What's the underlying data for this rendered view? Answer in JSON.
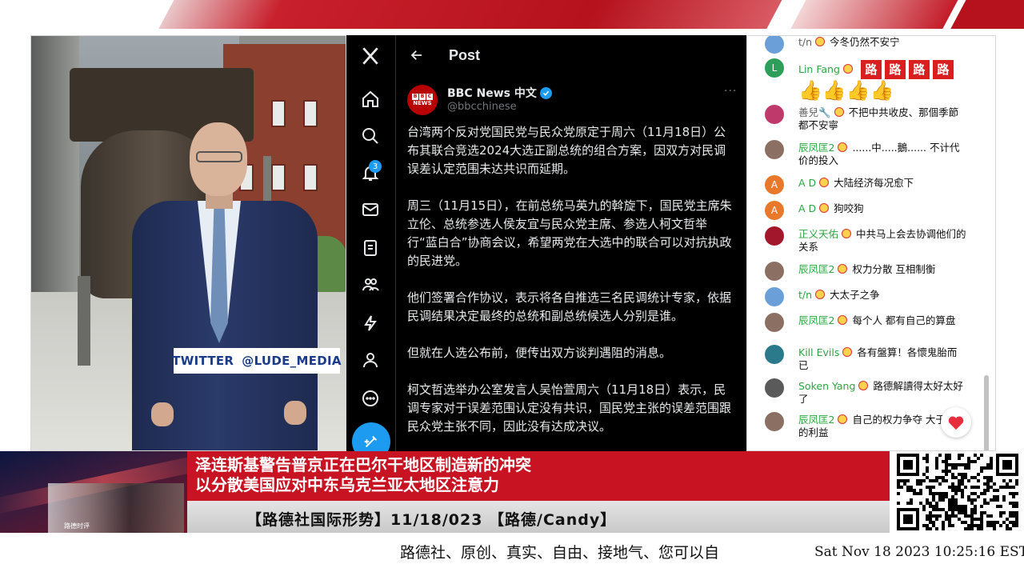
{
  "twitter_tag": {
    "prefix": "TWITTER",
    "handle": "@LUDE_MEDIA"
  },
  "x_app": {
    "header_title": "Post",
    "notification_count": "3",
    "author_name": "BBC News 中文",
    "author_handle": "@bbcchinese",
    "avatar_text": "NEWS",
    "more": "···",
    "paragraphs": [
      "台湾两个反对党国民党与民众党原定于周六（11月18日）公布其联合竞选2024大选正副总统的组合方案，因双方对民调误差认定范围未达共识而延期。",
      "周三（11月15日），在前总统马英九的斡旋下，国民党主席朱立伦、总统参选人侯友宜与民众党主席、参选人柯文哲举行“蓝白合”协商会议，希望两党在大选中的联合可以对抗执政的民进党。",
      "他们签署合作协议，表示将各自推选三名民调统计专家，依据民调结果决定最终的总统和副总统候选人分别是谁。",
      "但就在人选公布前，便传出双方谈判遇阻的消息。",
      "柯文哲选举办公室发言人吴怡萱周六（11月18日）表示，民调专家对于误差范围认定没有共识，国民党主张的误差范围跟民众党主张不同，因此没有达成决议。"
    ]
  },
  "chat": {
    "messages": [
      {
        "author": "t/n",
        "text": "今冬仍然不安宁",
        "avatar_color": "#6a9fd8",
        "avatar_letter": ""
      },
      {
        "author": "Lin Fang",
        "text": "",
        "avatar_color": "#2e9e5b",
        "avatar_letter": "L",
        "tiles": [
          "路",
          "路",
          "路",
          "路"
        ],
        "thumbs": "👍👍👍👍"
      },
      {
        "author": "善兒🔧",
        "text": "不把中共收皮、那個季節都不安寧",
        "avatar_color": "#c0396b",
        "avatar_letter": ""
      },
      {
        "author": "辰凤匡2",
        "text": "......中.....鵝...... 不计代价的投入",
        "avatar_color": "#8b6f63",
        "avatar_letter": ""
      },
      {
        "author": "A D",
        "text": "大陆经济每况愈下",
        "avatar_color": "#e8782a",
        "avatar_letter": "A"
      },
      {
        "author": "A D",
        "text": "狗咬狗",
        "avatar_color": "#e8782a",
        "avatar_letter": "A"
      },
      {
        "author": "正义天佑",
        "text": "中共马上会去协调他们的关系",
        "avatar_color": "#a3172c",
        "avatar_letter": ""
      },
      {
        "author": "辰凤匡2",
        "text": "权力分散 互相制衡",
        "avatar_color": "#8b6f63",
        "avatar_letter": ""
      },
      {
        "author": "t/n",
        "text": "大太子之争",
        "avatar_color": "#6a9fd8",
        "avatar_letter": ""
      },
      {
        "author": "辰凤匡2",
        "text": "每个人 都有自己的算盘",
        "avatar_color": "#8b6f63",
        "avatar_letter": ""
      },
      {
        "author": "Kill Evils",
        "text": "各有盤算！各懷鬼胎而已",
        "avatar_color": "#2b7a8c",
        "avatar_letter": ""
      },
      {
        "author": "Soken Yang",
        "text": "路德解讀得太好太好了",
        "avatar_color": "#5a5a5a",
        "avatar_letter": ""
      },
      {
        "author": "辰凤匡2",
        "text": "自己的权力争夺 大于国家的利益",
        "avatar_color": "#8b6f63",
        "avatar_letter": ""
      }
    ]
  },
  "lower_third": {
    "headline_line1": "泽连斯基警告普京正在巴尔干地区制造新的冲突",
    "headline_line2": "以分散美国应对中东乌克兰亚太地区注意力",
    "subline": "【路德社国际形势】11/18/023 【路德/Candy】",
    "thumb_caption": "路德时评"
  },
  "ticker": "路德社、原创、真实、自由、接地气、您可以自",
  "clock": "Sat Nov 18 2023 10:25:16 EST",
  "colors": {
    "accent_red": "#c81422",
    "x_blue": "#1d9bf0",
    "chat_green": "#2ba640"
  }
}
